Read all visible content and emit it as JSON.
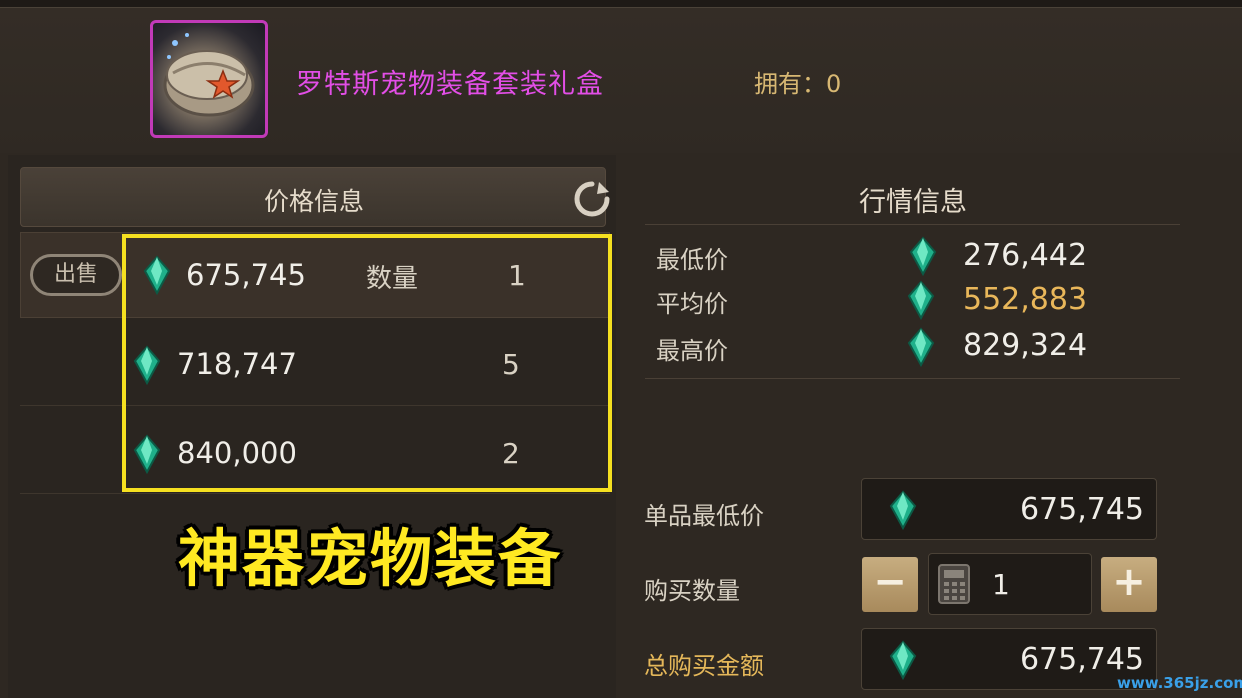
{
  "item": {
    "name": "罗特斯宠物装备套装礼盒",
    "owned": "拥有：0",
    "frame_color": "#c13ab8"
  },
  "price_info": {
    "title": "价格信息",
    "sell_button": "出售",
    "qty_label": "数量",
    "rows": [
      {
        "price": "675,745",
        "qty": "1"
      },
      {
        "price": "718,747",
        "qty": "5"
      },
      {
        "price": "840,000",
        "qty": "2"
      }
    ],
    "icons": {
      "refresh": "refresh-icon",
      "currency": "gem-icon"
    }
  },
  "market": {
    "title": "行情信息",
    "lowest_label": "最低价",
    "lowest_value": "276,442",
    "average_label": "平均价",
    "average_value": "552,883",
    "highest_label": "最高价",
    "highest_value": "829,324"
  },
  "purchase": {
    "unit_price_label": "单品最低价",
    "unit_price_value": "675,745",
    "quantity_label": "购买数量",
    "quantity_value": "1",
    "minus": "−",
    "plus": "+",
    "total_label": "总购买金额",
    "total_value": "675,745"
  },
  "overlay": {
    "caption": "神器宠物装备",
    "highlight_color": "#f5e020"
  },
  "watermark": "www.365jz.com"
}
